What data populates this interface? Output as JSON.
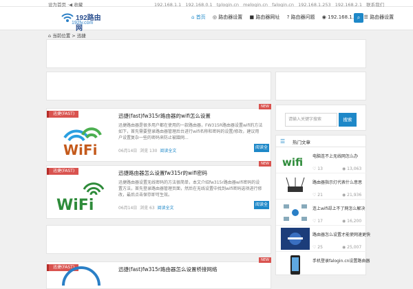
{
  "topbar": {
    "left": "设为首页 ·◀ 收藏",
    "links": [
      "192.168.1.1",
      "192.168.0.1",
      "tplogin.cn",
      "melogin.cn",
      "falogin.cn",
      "192.168.1.253",
      "192.168.2.1",
      "联系我们"
    ]
  },
  "logo": {
    "title": "192路由网",
    "sub": "192ly.com"
  },
  "nav": [
    {
      "icon": "⌂",
      "label": "首页",
      "active": true
    },
    {
      "icon": "◎",
      "label": "路由器设置"
    },
    {
      "icon": "■",
      "label": "路由器网址"
    },
    {
      "icon": "?",
      "label": "路由器问题"
    },
    {
      "icon": "◉",
      "label": "192.168.1.1"
    },
    {
      "icon": "☰",
      "label": "路由器设置"
    }
  ],
  "search_icon": "search-icon",
  "breadcrumb": "⌂ 当前位置 > 迅捷",
  "posts": [
    {
      "cat": "迅捷(FAST)",
      "title": "迅捷(fast)fw315r路由器的wifi怎么设置",
      "badge": "NEW",
      "desc": "迅捷路由器是很多用户都在使用的一款路由器，FW315R路由器设置wifi的方法如下，首先需要登录路由器管理后台进行wifi名称和密码的设置/修改，建议用户设置复杂一些的密码来防止被蹭网...",
      "date": "06月14日",
      "views": "浏览 130",
      "read": "阅读全文",
      "more": "阅读全文",
      "wifi": "WiFi"
    },
    {
      "cat": "迅捷(FAST)",
      "title": "迅捷路由器怎么设置fw315r的wifi密码",
      "badge": "NEW",
      "desc": "迅捷路由器设置无线密码的方法很简单，本文介绍fw315r路由器wifi密码的设置方法，首先登录路由器管理页面，然后在无线设置中找到wifi密码选项进行修改，最后点击保存即可生效。",
      "date": "06月14日",
      "views": "浏览 63",
      "read": "阅读全文",
      "more": "阅读全文",
      "wifi": "WiFi"
    },
    {
      "cat": "迅捷(FAST)",
      "title": "迅捷(fast)fw315r路由器怎么设置桥接网络",
      "badge": "NEW"
    }
  ],
  "sidebar": {
    "search_placeholder": "请输入关键字搜索",
    "search_btn": "搜索",
    "hot_title": "热门文章",
    "items": [
      {
        "title": "电脑连不上无线网怎么办",
        "likes": "13",
        "views": "13,063",
        "thumb_text": "wifi"
      },
      {
        "title": "路由器指示灯代表什么意思",
        "likes": "21",
        "views": "21,936"
      },
      {
        "title": "连上wifi却上不了网怎么解决",
        "likes": "17",
        "views": "16,200"
      },
      {
        "title": "路由器怎么设置才能使网速更快",
        "likes": "25",
        "views": "25,007"
      },
      {
        "title": "手机登录falogin.cn设置路由器",
        "likes": "",
        "views": ""
      }
    ]
  }
}
